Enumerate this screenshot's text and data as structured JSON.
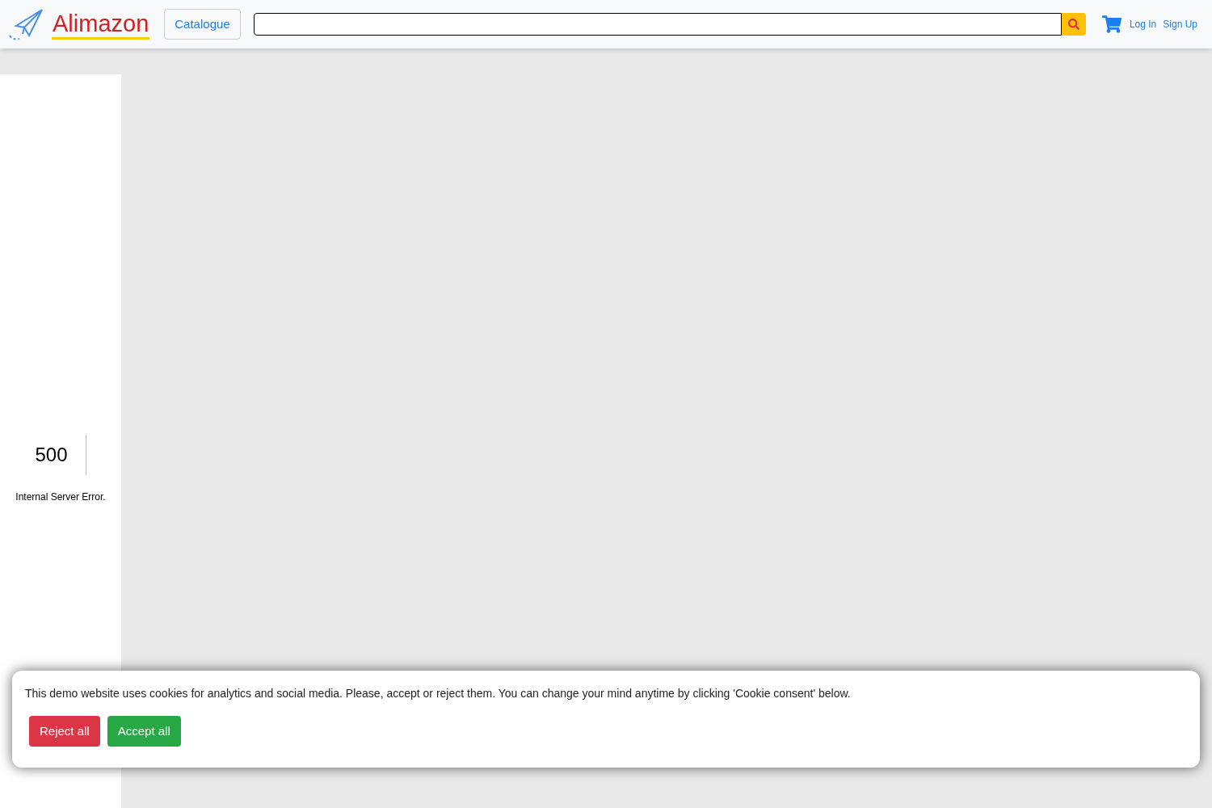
{
  "header": {
    "brand": "Alimazon",
    "catalogue_button": "Catalogue",
    "links": [
      "Log In",
      "Sign Up"
    ]
  },
  "error": {
    "code": "500",
    "message": "Internal Server Error."
  },
  "cookie_banner": {
    "text": "This demo website uses cookies for analytics and social media. Please, accept or reject them. You can change your mind anytime by clicking 'Cookie consent' below.",
    "buttons": [
      {
        "label": "Reject all",
        "kind": "reject"
      },
      {
        "label": "Accept all",
        "kind": "accept"
      }
    ]
  }
}
